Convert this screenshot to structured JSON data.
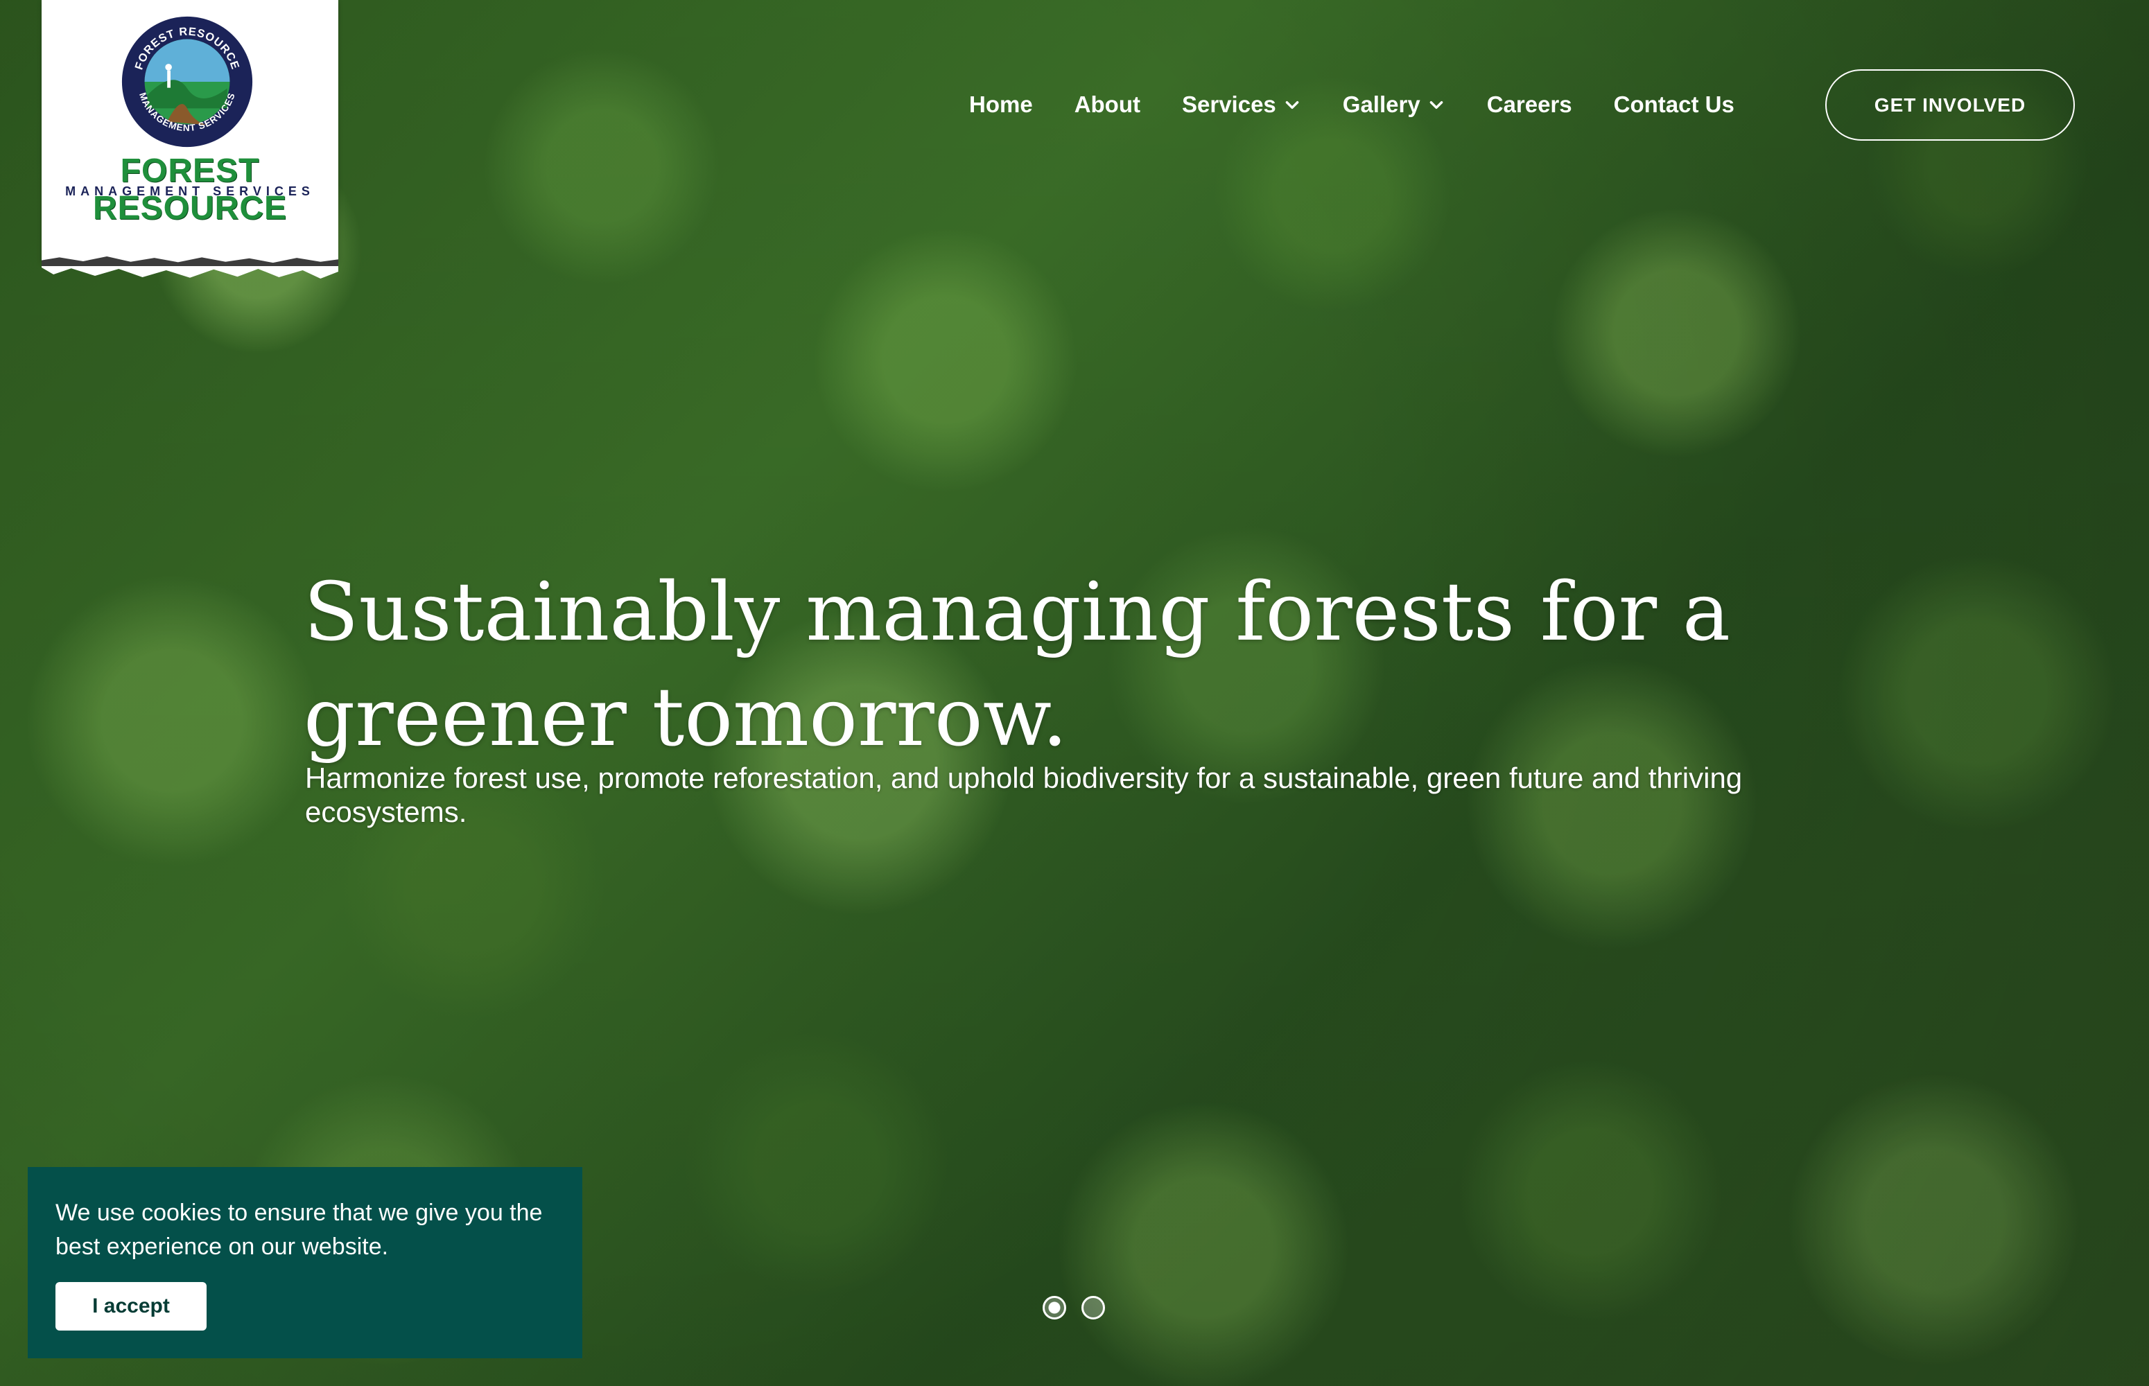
{
  "brand": {
    "name": "FOREST RESOURCE",
    "subtitle": "MANAGEMENT SERVICES",
    "seal_text_top": "FOREST RESOURCE",
    "seal_text_bottom": "MANAGEMENT SERVICES"
  },
  "nav": {
    "items": [
      {
        "label": "Home",
        "has_dropdown": false
      },
      {
        "label": "About",
        "has_dropdown": false
      },
      {
        "label": "Services",
        "has_dropdown": true
      },
      {
        "label": "Gallery",
        "has_dropdown": true
      },
      {
        "label": "Careers",
        "has_dropdown": false
      },
      {
        "label": "Contact Us",
        "has_dropdown": false
      }
    ],
    "cta_label": "GET INVOLVED"
  },
  "hero": {
    "headline": "Sustainably managing forests for a greener tomorrow.",
    "subtext": "Harmonize forest use, promote reforestation, and uphold biodiversity for a sustainable, green future and thriving ecosystems.",
    "slides": {
      "count": 2,
      "active": 1
    }
  },
  "cookie": {
    "message": "We use cookies to ensure that we give you the best experience on our website.",
    "accept_label": "I accept"
  },
  "colors": {
    "brand_green": "#1f8f3b",
    "brand_navy": "#1b2358",
    "cookie_bg": "#04504a"
  },
  "icons": {
    "dropdown": "chevron-down-icon"
  }
}
